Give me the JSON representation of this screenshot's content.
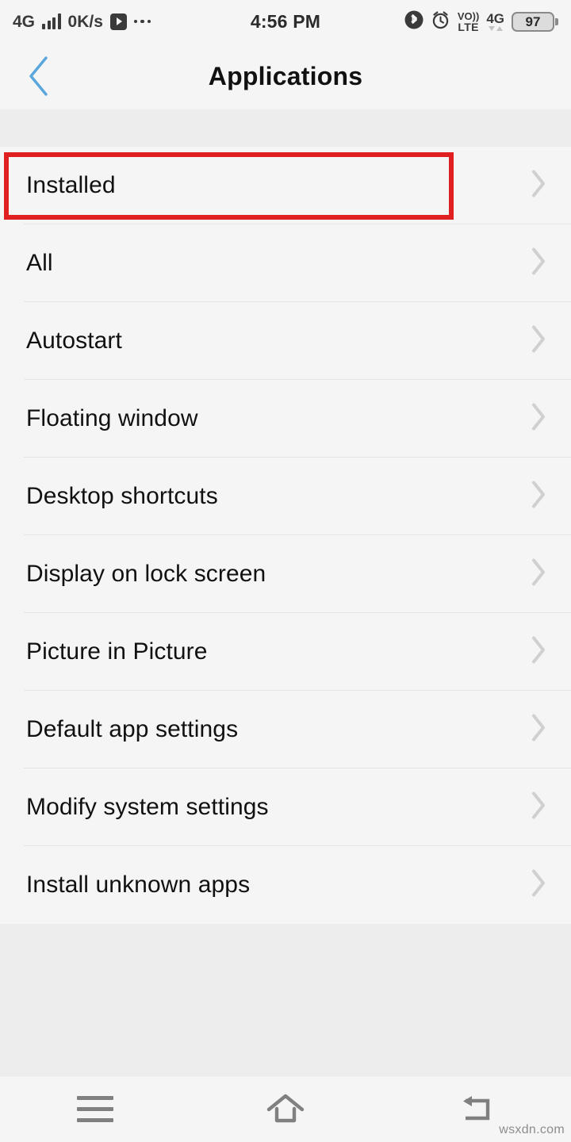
{
  "status_bar": {
    "network_type": "4G",
    "data_rate": "0K/s",
    "time": "4:56 PM",
    "volte_top": "VO))",
    "volte_bottom": "LTE",
    "network_right": "4G",
    "battery_level": "97",
    "icons": {
      "signal": "signal-bars-icon",
      "video": "video-play-icon",
      "overflow": "more-dots-icon",
      "bluetooth": "bluetooth-icon",
      "alarm": "alarm-clock-icon"
    }
  },
  "header": {
    "title": "Applications",
    "back_icon": "chevron-left-icon",
    "back_color": "#5aa7dd"
  },
  "list": {
    "items": [
      {
        "label": "Installed"
      },
      {
        "label": "All"
      },
      {
        "label": "Autostart"
      },
      {
        "label": "Floating window"
      },
      {
        "label": "Desktop shortcuts"
      },
      {
        "label": "Display on lock screen"
      },
      {
        "label": "Picture in Picture"
      },
      {
        "label": "Default app settings"
      },
      {
        "label": "Modify system settings"
      },
      {
        "label": "Install unknown apps"
      }
    ],
    "chevron_icon": "chevron-right-icon",
    "chevron_color": "#d0d0d0"
  },
  "annotation": {
    "target_label": "Installed",
    "color": "#e02020"
  },
  "nav_bar": {
    "menu_icon": "menu-hamburger-icon",
    "home_icon": "home-icon",
    "back_icon": "back-return-icon",
    "color": "#808080"
  },
  "watermark": {
    "text": "wsxdn.com"
  },
  "theme": {
    "surface": "#f5f5f5",
    "background": "#ededed",
    "divider": "#e4e4e4",
    "text": "#111111"
  }
}
